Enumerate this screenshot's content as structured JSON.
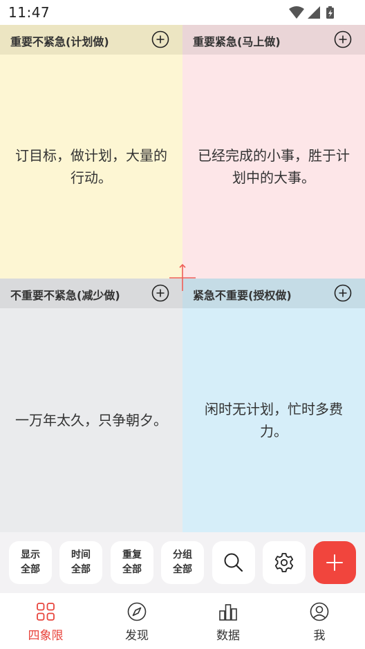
{
  "status_bar": {
    "time": "11:47",
    "icons": [
      "wifi-icon",
      "signal-icon",
      "battery-charging-icon"
    ]
  },
  "quadrants": {
    "top_left": {
      "title": "重要不紧急(计划做)",
      "text": "订目标，做计划，大量的行动。",
      "color": "#fdf6d3",
      "header_color": "#ece5c2"
    },
    "top_right": {
      "title": "重要紧急(马上做)",
      "text": "已经完成的小事，胜于计划中的大事。",
      "color": "#fde6e8",
      "header_color": "#ead5d7"
    },
    "bottom_left": {
      "title": "不重要不紧急(减少做)",
      "text": "一万年太久，只争朝夕。",
      "color": "#eaebed",
      "header_color": "#d9dadc"
    },
    "bottom_right": {
      "title": "紧急不重要(授权做)",
      "text": "闲时无计划，忙时多费力。",
      "color": "#d6eef9",
      "header_color": "#c5dce6"
    }
  },
  "toolbar": {
    "filters": [
      {
        "line1": "显示",
        "line2": "全部"
      },
      {
        "line1": "时间",
        "line2": "全部"
      },
      {
        "line1": "重复",
        "line2": "全部"
      },
      {
        "line1": "分组",
        "line2": "全部"
      }
    ],
    "icons": [
      "search-icon",
      "gear-icon",
      "plus-icon"
    ],
    "accent_color": "#f1453d"
  },
  "tabs": [
    {
      "label": "四象限",
      "icon": "grid-icon",
      "active": true
    },
    {
      "label": "发现",
      "icon": "compass-icon",
      "active": false
    },
    {
      "label": "数据",
      "icon": "bar-chart-icon",
      "active": false
    },
    {
      "label": "我",
      "icon": "user-icon",
      "active": false
    }
  ]
}
